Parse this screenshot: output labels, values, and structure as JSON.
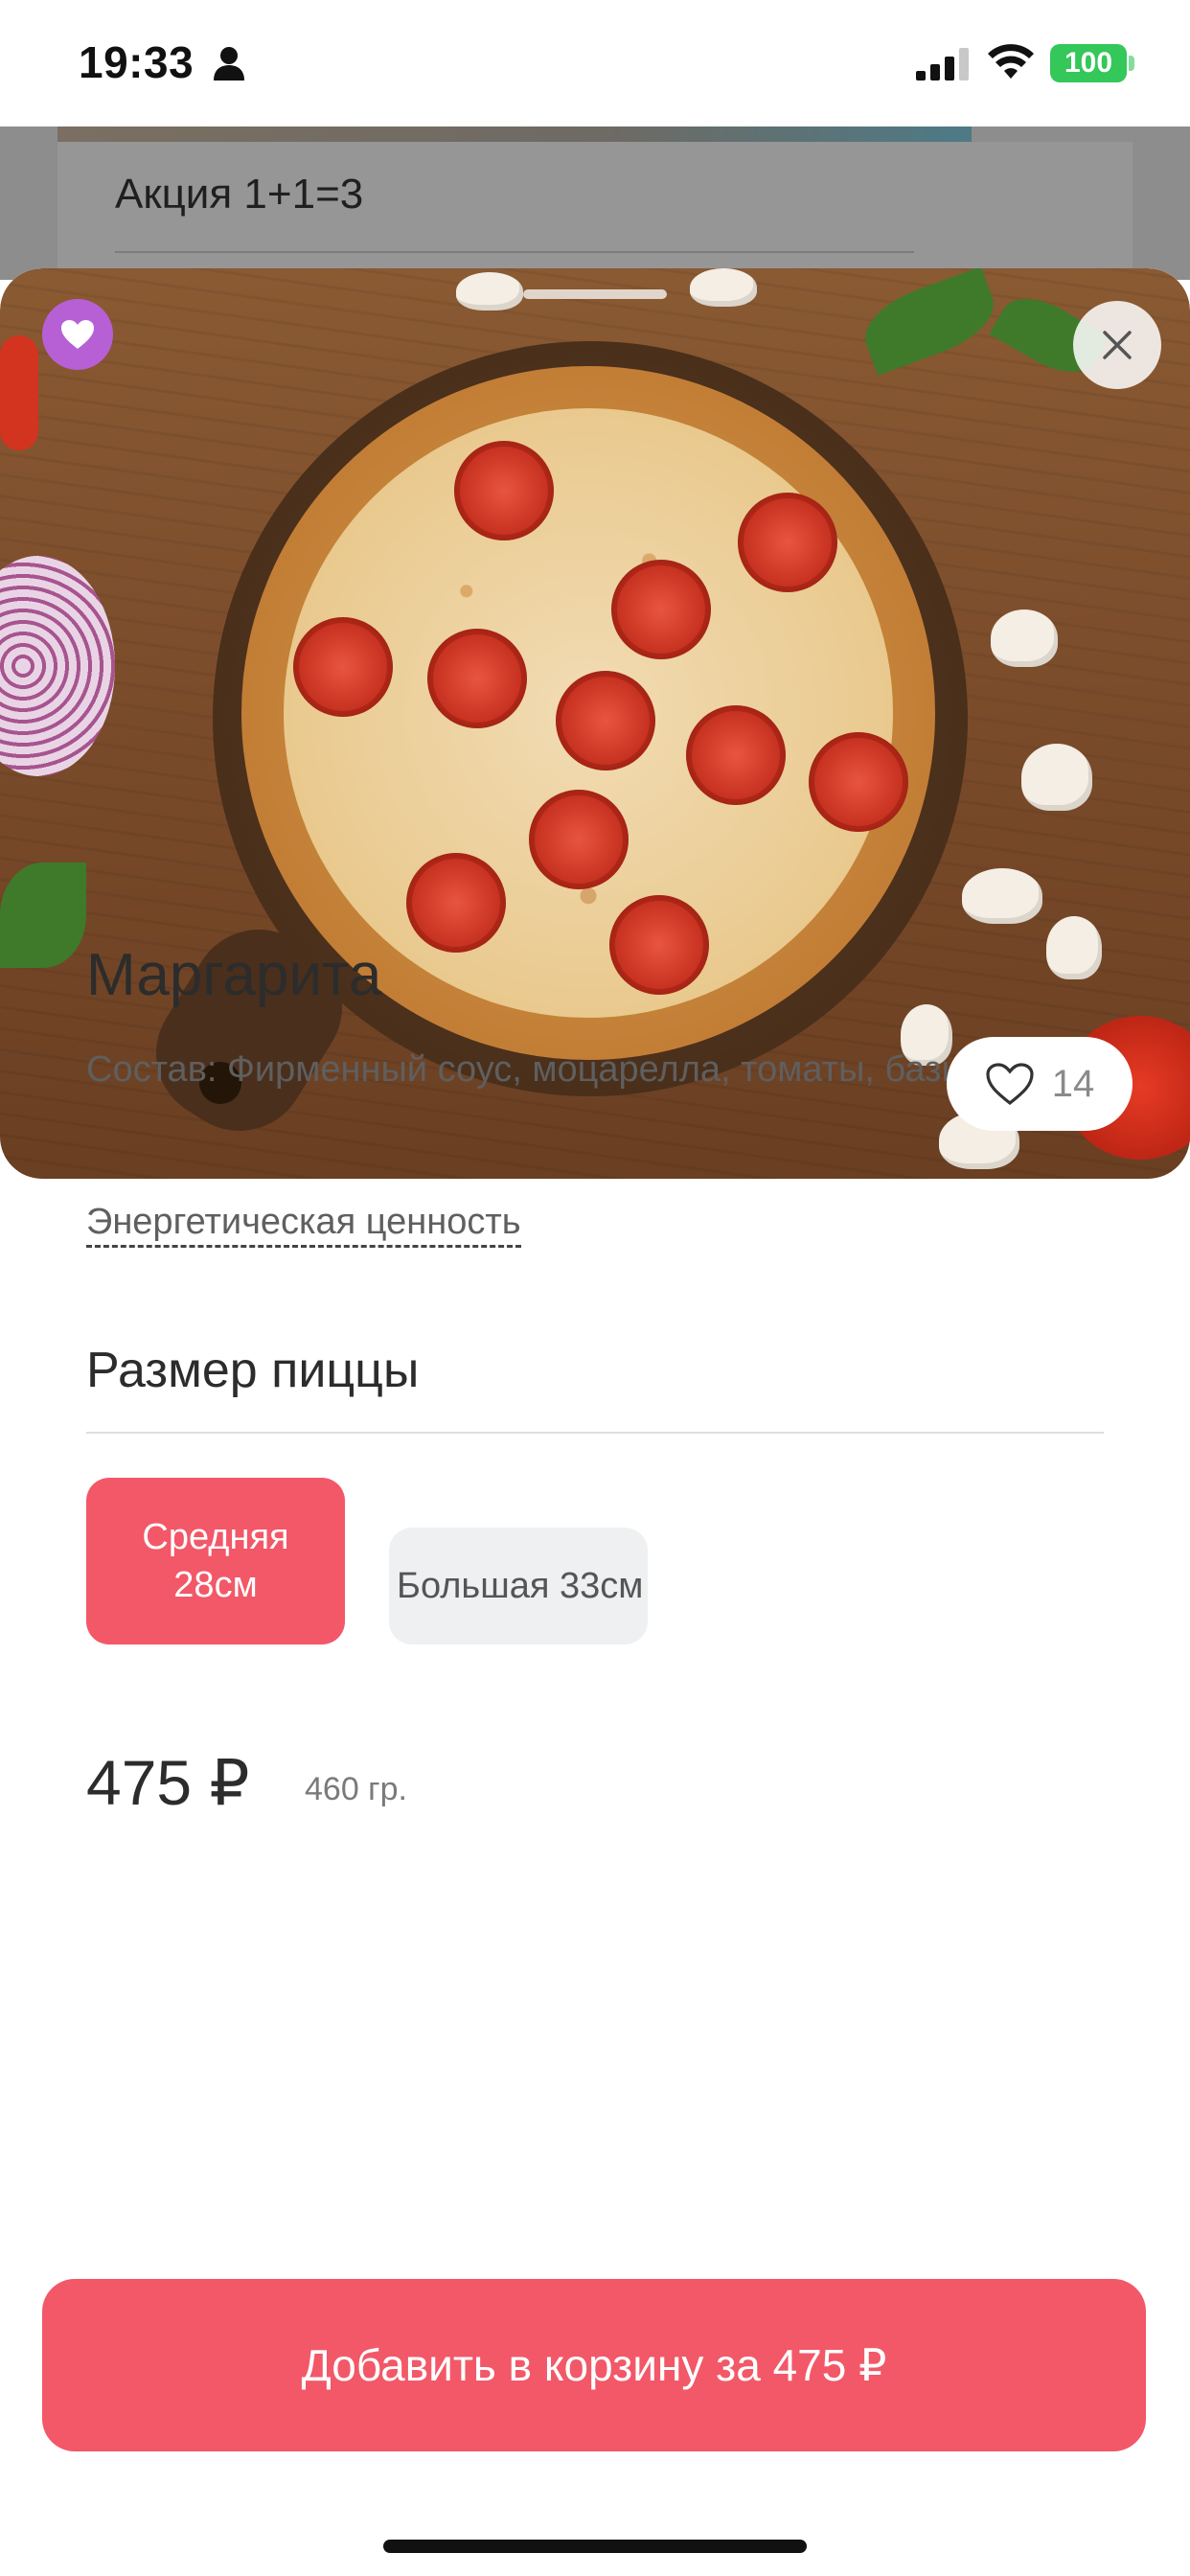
{
  "status_bar": {
    "time": "19:33",
    "battery": "100",
    "icons": [
      "person-icon",
      "signal-icon",
      "wifi-icon",
      "battery-icon"
    ]
  },
  "background": {
    "promo_label": "Акция 1+1=3"
  },
  "product": {
    "likes": "14",
    "title": "Маргарита",
    "composition": "Состав: Фирменный соус, моцарелла, томаты, базилик",
    "energy_link": "Энергетическая ценность",
    "size_section_title": "Размер пиццы",
    "sizes": [
      {
        "label": "Средняя\n28см",
        "selected": true
      },
      {
        "label": "Большая 33см",
        "selected": false
      }
    ],
    "price": "475 ₽",
    "weight": "460 гр."
  },
  "cta": {
    "add_to_cart": "Добавить в корзину за 475 ₽"
  },
  "colors": {
    "accent": "#f25868",
    "favorite_badge": "#b760d6",
    "battery": "#34c759"
  }
}
